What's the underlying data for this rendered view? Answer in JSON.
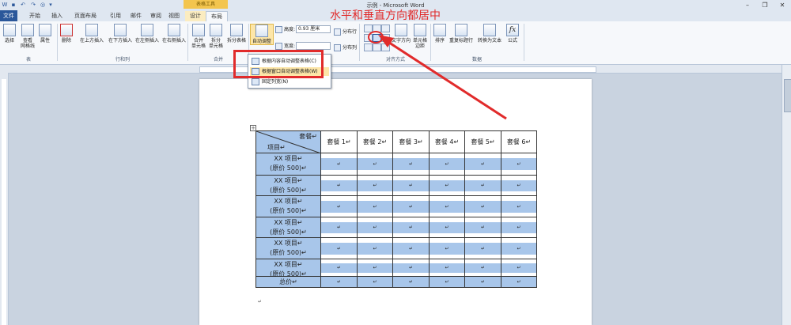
{
  "window": {
    "title": "示例 - Microsoft Word",
    "context_tab_group": "表格工具"
  },
  "tabs": [
    "文件",
    "开始",
    "插入",
    "页面布局",
    "引用",
    "邮件",
    "审阅",
    "视图",
    "设计",
    "布局"
  ],
  "ribbon": {
    "buttons": {
      "select": "选择",
      "view_gridlines_1": "查看",
      "view_gridlines_2": "网格线",
      "properties": "属性",
      "delete": "删除",
      "insert_above": "在上方插入",
      "insert_below": "在下方插入",
      "insert_left": "在左侧插入",
      "insert_right": "在右侧插入",
      "merge_1": "合并",
      "merge_2": "单元格",
      "split_cells_1": "拆分",
      "split_cells_2": "单元格",
      "split_table": "拆分表格",
      "autofit": "自动调整",
      "height_label": "高度:",
      "height_value": "0.93 厘米",
      "width_label": "宽度:",
      "distribute_rows": "分布行",
      "distribute_cols": "分布列",
      "text_direction": "文字方向",
      "cell_margins_1": "单元格",
      "cell_margins_2": "边距",
      "sort": "排序",
      "repeat_header": "重复标题行",
      "convert_to_text": "转换为文本",
      "formula": "公式"
    },
    "groups": {
      "table": "表",
      "rows_cols": "行和列",
      "merge": "合并",
      "alignment": "对齐方式",
      "data": "数据"
    }
  },
  "annotation": "水平和垂直方向都居中",
  "autofit_menu": [
    {
      "label": "根据内容自动调整表格(C)",
      "highlighted": false
    },
    {
      "label": "根据窗口自动调整表格(W)",
      "highlighted": true
    },
    {
      "label": "固定列宽(N)",
      "highlighted": false
    }
  ],
  "table": {
    "corner_top": "套餐",
    "corner_bottom": "项目",
    "headers": [
      "套餐 1",
      "套餐 2",
      "套餐 3",
      "套餐 4",
      "套餐 5",
      "套餐 6"
    ],
    "rows": [
      {
        "line1": "XX 项目",
        "line2": "(原价 500)"
      },
      {
        "line1": "XX 项目",
        "line2": "(原价 500)"
      },
      {
        "line1": "XX 项目",
        "line2": "(原价 500)"
      },
      {
        "line1": "XX 项目",
        "line2": "(原价 500)"
      },
      {
        "line1": "XX 项目",
        "line2": "(原价 500)"
      },
      {
        "line1": "XX 项目",
        "line2": "(原价 500)"
      }
    ],
    "total_label": "总价",
    "para_mark": "↵"
  },
  "colors": {
    "selection": "#a8c6ea",
    "annotation_red": "#e12b2b",
    "file_tab": "#2b579a"
  }
}
